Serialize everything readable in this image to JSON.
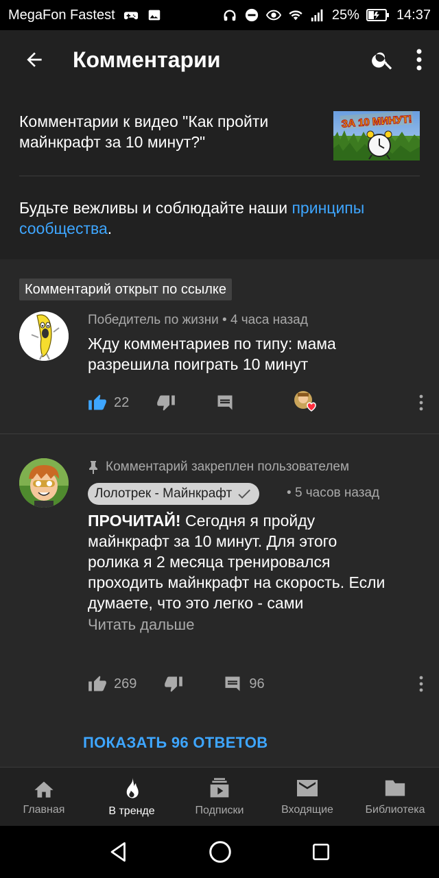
{
  "statusbar": {
    "carrier": "MegaFon Fastest",
    "battery": "25%",
    "time": "14:37"
  },
  "appbar": {
    "title": "Комментарии"
  },
  "video": {
    "title": "Комментарии к видео \"Как пройти майнкрафт за 10 минут?\"",
    "thumbnail_text": "ЗА 10 МИНУТ!"
  },
  "policy": {
    "text": "Будьте вежливы и соблюдайте наши ",
    "link": "принципы сообщества",
    "end": "."
  },
  "linked_chip": "Комментарий открыт по ссылке",
  "comment1": {
    "author": "Победитель по жизни",
    "time": "4 часа назад",
    "text": "Жду комментариев по типу: мама разрешила поиграть 10 минут",
    "likes": "22"
  },
  "comment2": {
    "pinned": "Комментарий закреплен пользователем",
    "author": "Лолотрек - Майнкрафт",
    "time": "5 часов назад",
    "bold": "ПРОЧИТАЙ!",
    "text": " Сегодня я пройду майнкрафт за 10 минут. Для этого ролика я 2 месяца тренировался проходить майнкрафт на скорость. Если думаете, что это легко - сами",
    "read_more": "Читать дальше",
    "likes": "269",
    "replies": "96"
  },
  "show_replies": "ПОКАЗАТЬ 96 ОТВЕТОВ",
  "nav": {
    "home": "Главная",
    "trending": "В тренде",
    "subscriptions": "Подписки",
    "inbox": "Входящие",
    "library": "Библиотека"
  },
  "colors": {
    "accent": "#3ea6ff",
    "background": "#282828",
    "header": "#212121",
    "muted_text": "#aaaaaa"
  }
}
